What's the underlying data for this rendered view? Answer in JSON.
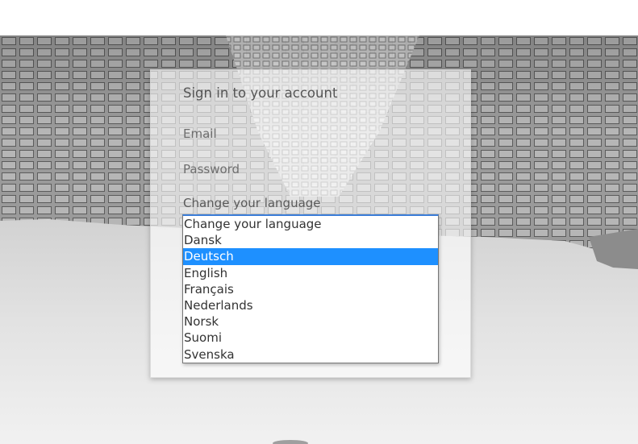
{
  "signin": {
    "title": "Sign in to your account",
    "email_placeholder": "Email",
    "password_placeholder": "Password",
    "language_label": "Change your language"
  },
  "language_select": {
    "selected": "Deutsch",
    "options": [
      "Change your language",
      "Dansk",
      "Deutsch",
      "English",
      "Français",
      "Nederlands",
      "Norsk",
      "Suomi",
      "Svenska"
    ]
  },
  "colors": {
    "highlight": "#1e90ff",
    "text": "#555555"
  },
  "background": {
    "description_icon": "building-grid-background"
  }
}
